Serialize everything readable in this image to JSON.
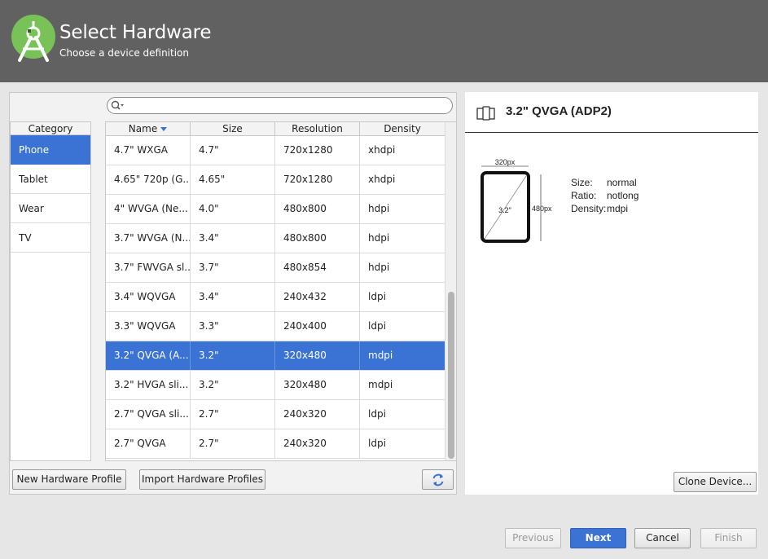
{
  "header": {
    "title": "Select Hardware",
    "subtitle": "Choose a device definition"
  },
  "search": {
    "placeholder": "",
    "value": ""
  },
  "categories": {
    "header": "Category",
    "items": [
      {
        "label": "Phone",
        "selected": true
      },
      {
        "label": "Tablet",
        "selected": false
      },
      {
        "label": "Wear",
        "selected": false
      },
      {
        "label": "TV",
        "selected": false
      }
    ]
  },
  "table": {
    "columns": [
      "Name",
      "Size",
      "Resolution",
      "Density"
    ],
    "sorted_by": "Name",
    "rows": [
      {
        "name": "4.7\" WXGA",
        "size": "4.7\"",
        "resolution": "720x1280",
        "density": "xhdpi"
      },
      {
        "name": "4.65\" 720p (G...",
        "size": "4.65\"",
        "resolution": "720x1280",
        "density": "xhdpi"
      },
      {
        "name": "4\" WVGA (Ne...",
        "size": "4.0\"",
        "resolution": "480x800",
        "density": "hdpi"
      },
      {
        "name": "3.7\" WVGA (N...",
        "size": "3.4\"",
        "resolution": "480x800",
        "density": "hdpi"
      },
      {
        "name": "3.7\" FWVGA sl...",
        "size": "3.7\"",
        "resolution": "480x854",
        "density": "hdpi"
      },
      {
        "name": "3.4\" WQVGA",
        "size": "3.4\"",
        "resolution": "240x432",
        "density": "ldpi"
      },
      {
        "name": "3.3\" WQVGA",
        "size": "3.3\"",
        "resolution": "240x400",
        "density": "ldpi"
      },
      {
        "name": "3.2\" QVGA (A...",
        "size": "3.2\"",
        "resolution": "320x480",
        "density": "mdpi",
        "selected": true
      },
      {
        "name": "3.2\" HVGA sli...",
        "size": "3.2\"",
        "resolution": "320x480",
        "density": "mdpi"
      },
      {
        "name": "2.7\" QVGA sli...",
        "size": "2.7\"",
        "resolution": "240x320",
        "density": "ldpi"
      },
      {
        "name": "2.7\" QVGA",
        "size": "2.7\"",
        "resolution": "240x320",
        "density": "ldpi"
      }
    ]
  },
  "buttons": {
    "new_profile": "New Hardware Profile",
    "import_profiles": "Import Hardware Profiles",
    "clone_device": "Clone Device...",
    "previous": "Previous",
    "next": "Next",
    "cancel": "Cancel",
    "finish": "Finish"
  },
  "details": {
    "title": "3.2\" QVGA (ADP2)",
    "preview": {
      "width_label": "320px",
      "height_label": "480px",
      "diagonal_label": "3.2\""
    },
    "size_label": "Size:",
    "size_value": "normal",
    "ratio_label": "Ratio:",
    "ratio_value": "notlong",
    "density_label": "Density:",
    "density_value": "mdpi"
  },
  "colors": {
    "header_bg": "#616161",
    "selection": "#3a73d4",
    "android_green": "#a4c639"
  }
}
